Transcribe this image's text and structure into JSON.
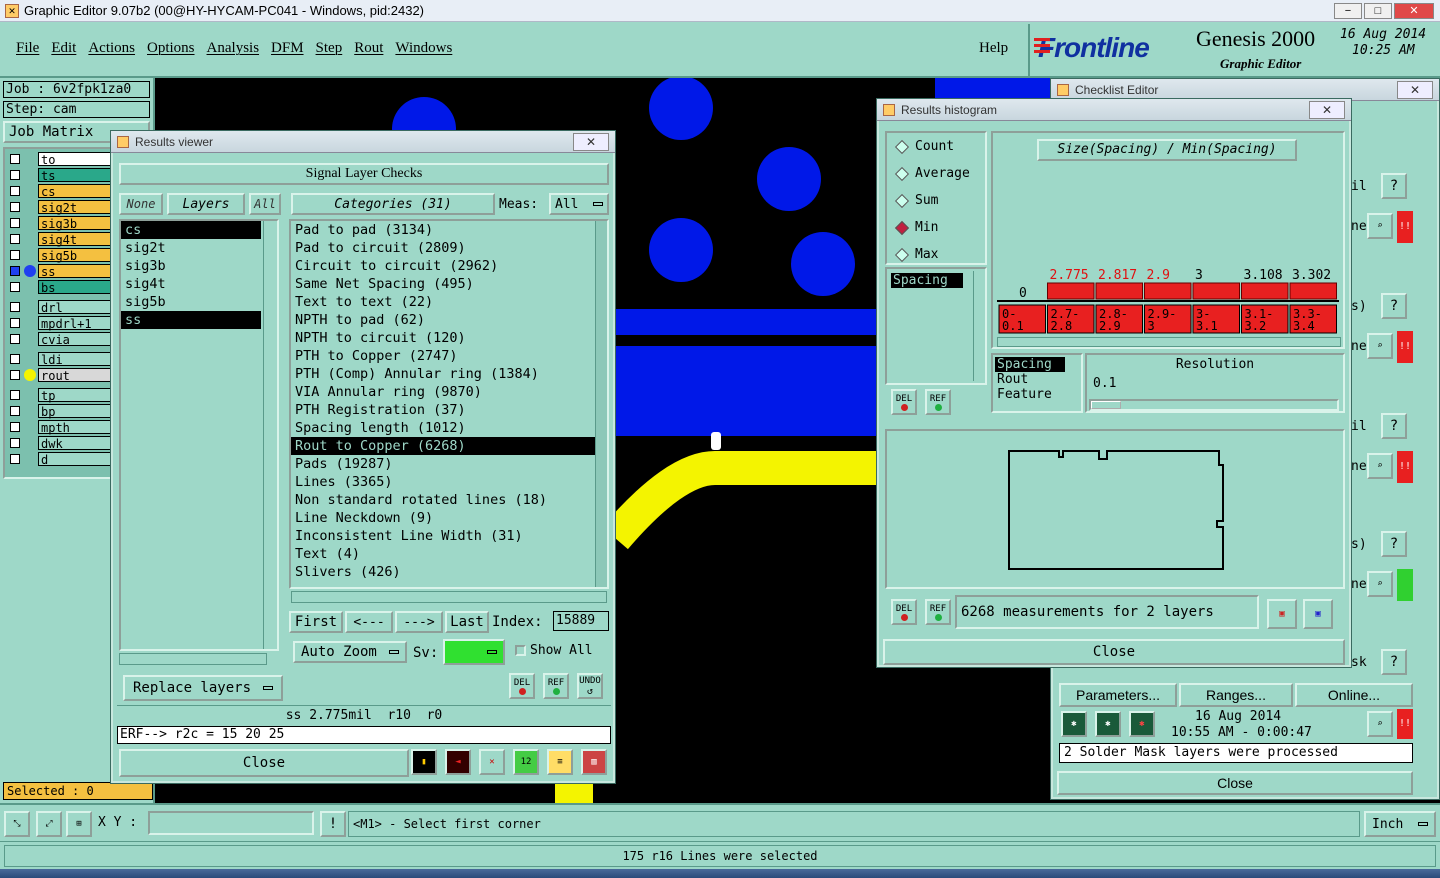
{
  "window": {
    "title": "Graphic Editor 9.07b2 (00@HY-HYCAM-PC041 - Windows, pid:2432)",
    "controls": [
      "−",
      "□",
      "✕"
    ]
  },
  "menu": {
    "items": [
      "File",
      "Edit",
      "Actions",
      "Options",
      "Analysis",
      "DFM",
      "Step",
      "Rout",
      "Windows"
    ],
    "help": "Help"
  },
  "brand": {
    "logo": "Frontline",
    "product": "Genesis 2000",
    "subtitle": "Graphic Editor",
    "date": "16 Aug 2014",
    "time": "10:25 AM"
  },
  "left": {
    "job": "Job : 6v2fpk1za0",
    "step": "Step: cam",
    "job_matrix": "Job Matrix",
    "selected": "Selected : 0",
    "layers": [
      {
        "name": "to",
        "color": "#ffffff"
      },
      {
        "name": "ts",
        "color": "#2aa88a"
      },
      {
        "name": "cs",
        "color": "#f4c040"
      },
      {
        "name": "sig2t",
        "color": "#f4c040"
      },
      {
        "name": "sig3b",
        "color": "#f4c040"
      },
      {
        "name": "sig4t",
        "color": "#f4c040"
      },
      {
        "name": "sig5b",
        "color": "#f4c040"
      },
      {
        "name": "ss",
        "color": "#f4c040"
      },
      {
        "name": "bs",
        "color": "#2aa88a"
      },
      {
        "name": "drl",
        "color": "#9ed8c8"
      },
      {
        "name": "mpdrl+1",
        "color": "#9ed8c8"
      },
      {
        "name": "cvia",
        "color": "#9ed8c8"
      },
      {
        "name": "ldi",
        "color": "#9ed8c8"
      },
      {
        "name": "rout",
        "color": "#d8d8d8"
      },
      {
        "name": "tp",
        "color": "#9ed8c8"
      },
      {
        "name": "bp",
        "color": "#9ed8c8"
      },
      {
        "name": "mpth",
        "color": "#9ed8c8"
      },
      {
        "name": "dwk",
        "color": "#9ed8c8"
      },
      {
        "name": "d",
        "color": "#9ed8c8"
      }
    ]
  },
  "results_viewer": {
    "title": "Results viewer",
    "header": "Signal Layer Checks",
    "none": "None",
    "layers_btn": "Layers",
    "all": "All",
    "categories_btn": "Categories (31)",
    "meas_label": "Meas:",
    "meas_value": "All",
    "layer_list": [
      "cs",
      "sig2t",
      "sig3b",
      "sig4t",
      "sig5b",
      "ss"
    ],
    "categories": [
      "Pad to pad (3134)",
      "Pad to circuit (2809)",
      "Circuit to circuit (2962)",
      "Same Net Spacing (495)",
      "Text to text (22)",
      "NPTH to pad (62)",
      "NPTH to circuit (120)",
      "PTH to Copper (2747)",
      "PTH (Comp) Annular ring (1384)",
      "VIA Annular ring (9870)",
      "PTH Registration (37)",
      "Spacing length (1012)",
      "Rout to Copper (6268)",
      "Pads (19287)",
      "Lines (3365)",
      "Non standard rotated lines (18)",
      "Line Neckdown (9)",
      "Inconsistent Line Width (31)",
      "Text (4)",
      "Slivers (426)"
    ],
    "selected_category": "Rout to Copper (6268)",
    "first": "First",
    "prev": "<---",
    "next": "--->",
    "last": "Last",
    "index_label": "Index:",
    "index_value": "15889",
    "auto_zoom": "Auto Zoom",
    "sv_label": "Sv:",
    "show_all": "Show All",
    "replace_layers": "Replace layers",
    "status": "ss 2.775mil  r10  r0",
    "erf": "ERF--> r2c = 15 20 25",
    "close": "Close",
    "del": "DEL",
    "ref": "REF",
    "undo": "UNDO"
  },
  "histogram": {
    "title": "Results histogram",
    "options": [
      "Count",
      "Average",
      "Sum",
      "Min",
      "Max"
    ],
    "selected_option": "Min",
    "chart_title": "Size(Spacing) / Min(Spacing)",
    "zero": "0",
    "bin_values": [
      "2.775",
      "2.817",
      "2.9",
      "3",
      "3.108",
      "3.302"
    ],
    "bin_ranges": [
      [
        "0-",
        "0.1"
      ],
      [
        "2.7-",
        "2.8"
      ],
      [
        "2.8-",
        "2.9"
      ],
      [
        "2.9-",
        "3"
      ],
      [
        "3-",
        "3.1"
      ],
      [
        "3.1-",
        "3.2"
      ],
      [
        "3.3-",
        "3.4"
      ]
    ],
    "spacing_item": "Spacing",
    "attr_list": [
      "Spacing",
      "Rout",
      "Feature"
    ],
    "resolution_label": "Resolution",
    "resolution_value": "0.1",
    "measurements": "6268 measurements for 2 layers",
    "close": "Close",
    "del": "DEL",
    "ref": "REF"
  },
  "checklist": {
    "title": "Checklist Editor",
    "params": "Parameters...",
    "ranges": "Ranges...",
    "online": "Online...",
    "date": "16 Aug 2014",
    "time": "10:55 AM - 0:00:47",
    "message": "2 Solder Mask layers were processed",
    "close": "Close",
    "row_labels": [
      "il",
      "ne...",
      "s)",
      "ne...",
      "il",
      "ne...",
      "s)",
      "ne...",
      "sk"
    ],
    "q": "?",
    "excl": "!!"
  },
  "bottom": {
    "xy_label": "X Y :",
    "prompt": "<M1> - Select first corner",
    "units": "Inch",
    "status": "175 r16 Lines were selected"
  },
  "colors": {
    "ui": "#9ed8c8",
    "blue": "#0018e8",
    "yellow": "#f4f400",
    "red": "#e82020"
  }
}
